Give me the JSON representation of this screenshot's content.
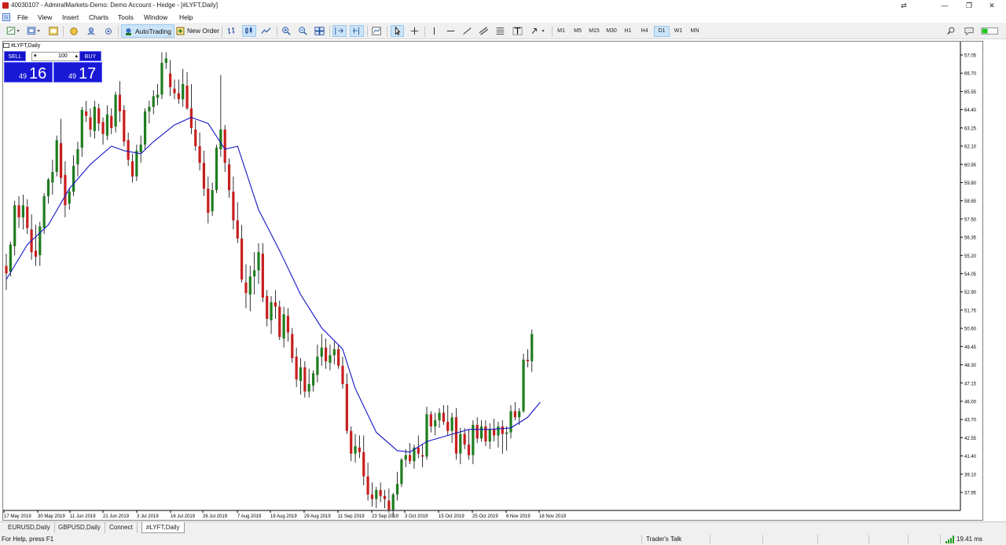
{
  "window": {
    "title": "40030107 - AdmiralMarkets-Demo: Demo Account - Hedge - [#LYFT,Daily]",
    "minimize": "—",
    "maximize": "❐",
    "close": "✕"
  },
  "menu": [
    "File",
    "View",
    "Insert",
    "Charts",
    "Tools",
    "Window",
    "Help"
  ],
  "toolbar": {
    "autotrading": "AutoTrading",
    "new_order": "New Order",
    "timeframes": [
      "M1",
      "M5",
      "M15",
      "M30",
      "H1",
      "H4",
      "D1",
      "W1",
      "MN"
    ],
    "active_timeframe": "D1",
    "icons": [
      "new-chart-icon",
      "profiles-icon",
      "market-watch-icon",
      "navigator-icon",
      "terminal-icon",
      "strategy-tester-icon",
      "bar-chart-icon",
      "candlestick-icon",
      "line-chart-icon",
      "zoom-in-icon",
      "zoom-out-icon",
      "tile-windows-icon",
      "auto-scroll-icon",
      "chart-shift-icon",
      "indicators-icon",
      "cursor-icon",
      "crosshair-icon",
      "vertical-line-icon",
      "horizontal-line-icon",
      "trendline-icon",
      "equidistant-channel-icon",
      "fibonacci-icon",
      "text-icon",
      "arrows-icon"
    ]
  },
  "chart": {
    "caption": "#LYFT,Daily",
    "trade_panel": {
      "sell_label": "SELL",
      "buy_label": "BUY",
      "volume": "100",
      "sell_small": "49",
      "sell_big": "16",
      "buy_small": "49",
      "buy_big": "17"
    }
  },
  "chart_data": {
    "type": "candlestick",
    "symbol": "#LYFT",
    "timeframe": "Daily",
    "y_ticks": [
      "57.05",
      "66.70",
      "65.55",
      "64.40",
      "63.25",
      "62.10",
      "60.95",
      "59.80",
      "58.65",
      "57.50",
      "56.35",
      "55.20",
      "54.05",
      "52.90",
      "51.75",
      "50.60",
      "49.45",
      "48.30",
      "47.15",
      "46.00",
      "43.70",
      "42.55",
      "41.40",
      "39.10",
      "37.95"
    ],
    "x_ticks": [
      "17 May 2019",
      "30 May 2019",
      "11 Jun 2019",
      "21 Jun 2019",
      "3 Jul 2019",
      "16 Jul 2019",
      "26 Jul 2019",
      "7 Aug 2019",
      "19 Aug 2019",
      "29 Aug 2019",
      "11 Sep 2019",
      "23 Sep 2019",
      "3 Oct 2019",
      "15 Oct 2019",
      "25 Oct 2019",
      "6 Nov 2019",
      "18 Nov 2019"
    ],
    "y_range": [
      37.5,
      68.3
    ],
    "bull_color": "#1e7d1e",
    "bear_color": "#c81e1e",
    "ma_color": "#1414c8",
    "candles": [
      [
        53.6,
        54.4,
        52.0,
        53.1
      ],
      [
        53.2,
        55.2,
        52.9,
        55.0
      ],
      [
        54.9,
        57.9,
        54.3,
        57.6
      ],
      [
        57.6,
        58.2,
        56.1,
        56.8
      ],
      [
        56.8,
        58.3,
        56.0,
        57.6
      ],
      [
        57.5,
        58.0,
        55.7,
        56.1
      ],
      [
        56.0,
        57.0,
        54.0,
        54.5
      ],
      [
        54.6,
        56.3,
        53.6,
        54.2
      ],
      [
        54.3,
        56.5,
        53.6,
        56.2
      ],
      [
        56.1,
        58.4,
        55.7,
        58.2
      ],
      [
        58.2,
        59.4,
        57.7,
        59.3
      ],
      [
        59.1,
        60.6,
        58.3,
        59.8
      ],
      [
        59.8,
        62.2,
        59.5,
        61.9
      ],
      [
        61.7,
        63.3,
        59.0,
        59.4
      ],
      [
        59.6,
        60.5,
        56.8,
        57.6
      ],
      [
        57.7,
        58.7,
        57.3,
        58.5
      ],
      [
        58.5,
        60.9,
        58.2,
        60.2
      ],
      [
        60.3,
        61.8,
        59.5,
        61.3
      ],
      [
        61.4,
        64.1,
        60.8,
        63.9
      ],
      [
        63.8,
        64.5,
        63.1,
        63.5
      ],
      [
        63.4,
        64.0,
        62.1,
        62.6
      ],
      [
        62.5,
        64.5,
        62.0,
        64.1
      ],
      [
        64.0,
        64.3,
        62.5,
        63.0
      ],
      [
        63.1,
        63.4,
        61.6,
        62.3
      ],
      [
        62.2,
        64.2,
        61.9,
        63.6
      ],
      [
        63.5,
        64.0,
        62.3,
        62.7
      ],
      [
        62.8,
        65.1,
        62.4,
        64.9
      ],
      [
        64.9,
        65.8,
        63.1,
        63.8
      ],
      [
        63.9,
        64.2,
        61.5,
        61.8
      ],
      [
        61.9,
        62.4,
        60.2,
        60.6
      ],
      [
        60.5,
        61.0,
        59.1,
        59.5
      ],
      [
        59.5,
        61.6,
        59.2,
        61.2
      ],
      [
        61.1,
        62.2,
        60.4,
        61.6
      ],
      [
        61.6,
        64.0,
        61.3,
        63.8
      ],
      [
        63.8,
        64.5,
        63.0,
        64.1
      ],
      [
        64.1,
        65.2,
        63.6,
        64.8
      ],
      [
        64.7,
        65.6,
        64.2,
        64.9
      ],
      [
        64.9,
        67.7,
        64.6,
        67.0
      ],
      [
        67.0,
        67.7,
        66.6,
        67.3
      ],
      [
        66.3,
        67.2,
        64.8,
        65.4
      ],
      [
        65.3,
        65.9,
        64.6,
        65.0
      ],
      [
        65.0,
        65.9,
        64.3,
        64.6
      ],
      [
        64.6,
        66.6,
        64.1,
        65.6
      ],
      [
        65.5,
        66.4,
        63.9,
        64.0
      ],
      [
        64.0,
        65.6,
        62.3,
        62.7
      ],
      [
        62.6,
        63.2,
        61.2,
        61.5
      ],
      [
        61.5,
        62.4,
        59.9,
        60.4
      ],
      [
        60.4,
        61.2,
        58.2,
        58.7
      ],
      [
        58.7,
        59.5,
        56.4,
        57.1
      ],
      [
        57.2,
        59.1,
        56.9,
        58.6
      ],
      [
        58.6,
        61.6,
        58.4,
        61.4
      ],
      [
        61.3,
        66.2,
        60.8,
        62.6
      ],
      [
        62.6,
        62.9,
        59.8,
        60.4
      ],
      [
        60.3,
        60.7,
        58.1,
        58.6
      ],
      [
        58.5,
        59.5,
        56.0,
        56.6
      ],
      [
        56.6,
        57.8,
        55.1,
        55.4
      ],
      [
        55.4,
        56.3,
        52.5,
        52.7
      ],
      [
        52.5,
        53.7,
        50.8,
        51.8
      ],
      [
        51.7,
        53.6,
        50.6,
        52.9
      ],
      [
        52.9,
        54.5,
        51.7,
        53.3
      ],
      [
        53.3,
        55.1,
        52.4,
        54.5
      ],
      [
        54.4,
        55.1,
        51.2,
        51.5
      ],
      [
        51.6,
        52.0,
        49.6,
        50.1
      ],
      [
        50.0,
        51.6,
        49.1,
        51.2
      ],
      [
        51.2,
        52.0,
        50.1,
        50.9
      ],
      [
        50.9,
        51.3,
        48.7,
        48.9
      ],
      [
        48.8,
        50.9,
        48.2,
        50.4
      ],
      [
        50.3,
        50.8,
        48.6,
        49.2
      ],
      [
        49.1,
        49.5,
        47.2,
        47.5
      ],
      [
        47.6,
        48.2,
        45.6,
        46.1
      ],
      [
        46.0,
        47.5,
        45.1,
        46.9
      ],
      [
        46.9,
        47.3,
        44.9,
        45.3
      ],
      [
        45.3,
        46.8,
        44.9,
        45.8
      ],
      [
        45.7,
        46.7,
        45.3,
        46.5
      ],
      [
        46.4,
        48.4,
        45.9,
        47.6
      ],
      [
        47.6,
        49.1,
        47.0,
        48.2
      ],
      [
        48.2,
        48.8,
        46.8,
        47.3
      ],
      [
        47.2,
        48.4,
        46.7,
        47.7
      ],
      [
        47.7,
        48.6,
        47.1,
        48.1
      ],
      [
        48.1,
        48.4,
        46.8,
        47.0
      ],
      [
        47.0,
        47.6,
        45.5,
        45.8
      ],
      [
        45.8,
        46.5,
        42.5,
        42.7
      ],
      [
        42.7,
        43.0,
        40.7,
        41.2
      ],
      [
        41.2,
        42.5,
        40.6,
        41.7
      ],
      [
        41.6,
        42.4,
        40.9,
        41.3
      ],
      [
        41.3,
        42.4,
        39.1,
        39.7
      ],
      [
        39.7,
        40.6,
        38.1,
        38.5
      ],
      [
        38.5,
        39.3,
        37.7,
        38.2
      ],
      [
        38.2,
        39.0,
        37.6,
        38.8
      ],
      [
        38.8,
        39.3,
        38.0,
        38.4
      ],
      [
        38.4,
        38.8,
        37.6,
        38.2
      ],
      [
        38.1,
        38.9,
        37.3,
        37.5
      ],
      [
        37.5,
        38.6,
        37.0,
        38.5
      ],
      [
        38.5,
        40.0,
        38.1,
        39.2
      ],
      [
        39.2,
        40.9,
        39.0,
        40.8
      ],
      [
        40.8,
        41.5,
        40.3,
        41.1
      ],
      [
        41.1,
        41.9,
        40.5,
        40.7
      ],
      [
        40.7,
        41.8,
        40.2,
        41.6
      ],
      [
        41.6,
        42.4,
        40.9,
        41.2
      ],
      [
        41.1,
        41.8,
        40.3,
        41.0
      ],
      [
        41.0,
        44.3,
        40.8,
        43.8
      ],
      [
        43.8,
        44.0,
        42.6,
        43.0
      ],
      [
        43.0,
        43.9,
        42.4,
        43.4
      ],
      [
        43.4,
        44.2,
        42.9,
        43.9
      ],
      [
        43.9,
        44.4,
        43.1,
        43.3
      ],
      [
        43.3,
        44.4,
        42.4,
        42.7
      ],
      [
        42.7,
        43.9,
        41.9,
        43.6
      ],
      [
        43.6,
        44.2,
        40.8,
        41.2
      ],
      [
        41.2,
        42.9,
        40.5,
        42.5
      ],
      [
        42.5,
        42.9,
        41.5,
        41.8
      ],
      [
        41.8,
        42.8,
        40.8,
        41.1
      ],
      [
        41.1,
        43.4,
        40.5,
        43.1
      ],
      [
        43.1,
        43.6,
        41.9,
        42.2
      ],
      [
        42.2,
        43.4,
        42.0,
        43.0
      ],
      [
        43.0,
        43.4,
        41.7,
        42.0
      ],
      [
        42.0,
        43.2,
        41.5,
        42.8
      ],
      [
        42.8,
        43.5,
        42.0,
        42.4
      ],
      [
        42.4,
        43.3,
        41.6,
        43.0
      ],
      [
        43.0,
        43.4,
        41.2,
        42.5
      ],
      [
        42.5,
        43.0,
        41.4,
        42.6
      ],
      [
        42.6,
        44.4,
        42.2,
        44.0
      ],
      [
        44.0,
        44.6,
        43.4,
        43.6
      ],
      [
        43.6,
        44.2,
        43.1,
        44.0
      ],
      [
        44.0,
        47.8,
        43.9,
        47.4
      ],
      [
        47.4,
        48.1,
        46.9,
        47.3
      ],
      [
        47.3,
        49.4,
        46.6,
        49.1
      ]
    ],
    "moving_average": [
      [
        0,
        52.7
      ],
      [
        5,
        55.0
      ],
      [
        10,
        56.3
      ],
      [
        15,
        58.7
      ],
      [
        20,
        60.3
      ],
      [
        25,
        61.5
      ],
      [
        28,
        61.2
      ],
      [
        32,
        61.0
      ],
      [
        35,
        61.8
      ],
      [
        40,
        62.9
      ],
      [
        44,
        63.4
      ],
      [
        48,
        63.0
      ],
      [
        52,
        61.3
      ],
      [
        55,
        61.5
      ],
      [
        60,
        57.3
      ],
      [
        65,
        54.6
      ],
      [
        70,
        51.7
      ],
      [
        75,
        49.5
      ],
      [
        80,
        48.1
      ],
      [
        83,
        45.5
      ],
      [
        88,
        42.6
      ],
      [
        93,
        41.4
      ],
      [
        96,
        41.3
      ],
      [
        100,
        42.0
      ],
      [
        105,
        42.4
      ],
      [
        110,
        42.8
      ],
      [
        115,
        42.8
      ],
      [
        120,
        42.9
      ],
      [
        124,
        43.6
      ],
      [
        127,
        44.6
      ]
    ]
  },
  "tabs": [
    "EURUSD,Daily",
    "GBPUSD,Daily",
    "Connect",
    "#LYFT,Daily"
  ],
  "active_tab": "#LYFT,Daily",
  "status": {
    "help": "For Help, press F1",
    "traders_talk": "Trader's Talk",
    "ping": "19.41 ms"
  }
}
